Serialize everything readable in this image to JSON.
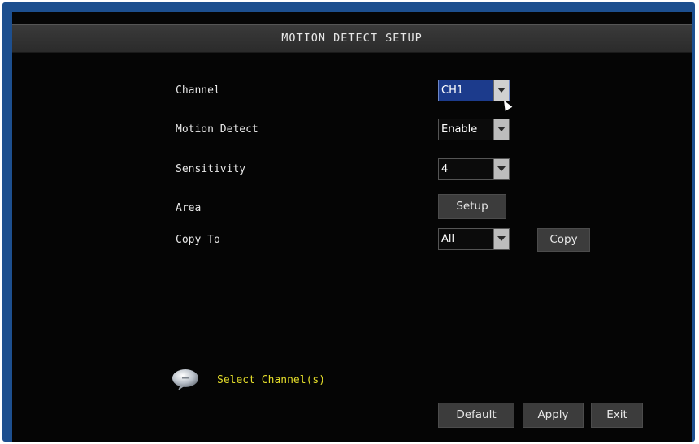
{
  "window": {
    "title": "MOTION DETECT SETUP"
  },
  "form": {
    "channel": {
      "label": "Channel",
      "value": "CH1"
    },
    "motion_detect": {
      "label": "Motion Detect",
      "value": "Enable"
    },
    "sensitivity": {
      "label": "Sensitivity",
      "value": "4"
    },
    "area": {
      "label": "Area",
      "button": "Setup"
    },
    "copy_to": {
      "label": "Copy To",
      "value": "All",
      "button": "Copy"
    }
  },
  "tip": {
    "icon": "speech-bubble-icon",
    "text": "Select Channel(s)"
  },
  "footer": {
    "default": "Default",
    "apply": "Apply",
    "exit": "Exit"
  },
  "colors": {
    "frame": "#1d4f8f",
    "background": "#050505",
    "selected": "#1c3b8c",
    "tip_text": "#e3dc2a"
  }
}
